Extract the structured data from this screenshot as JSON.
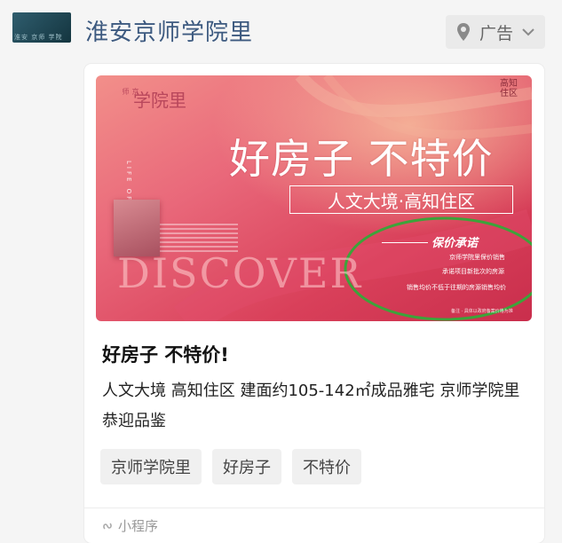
{
  "header": {
    "avatar_text": "淮安 京师 学院",
    "account_name": "淮安京师学院里",
    "ad_label": "广告",
    "icons": [
      "location-pin-icon",
      "chevron-down-icon"
    ]
  },
  "banner": {
    "brand_small": "京师",
    "brand_name": "学院里",
    "corner_text": "高知住区",
    "headline": "好房子 不特价",
    "subheadline": "人文大境·高知住区",
    "vertical_text": "LIFE OF PINNACLE",
    "watermark": "DISCOVER",
    "promise_title": "保价承诺",
    "promise_lines": [
      "京师学院里保价销售",
      "承诺项目新批次的房源",
      "销售均价不低于往期的房源销售均价"
    ],
    "footer": "备注 · 具体以政府备案价格为准",
    "colors": {
      "primary": "#d9475e",
      "accent": "#f2a08a",
      "highlight_ring": "#3da33a"
    }
  },
  "card": {
    "title": "好房子 不特价!",
    "description": "人文大境 高知住区 建面约105-142㎡成品雅宅 京师学院里恭迎品鉴",
    "tags": [
      "京师学院里",
      "好房子",
      "不特价"
    ],
    "footer_label": "小程序"
  }
}
